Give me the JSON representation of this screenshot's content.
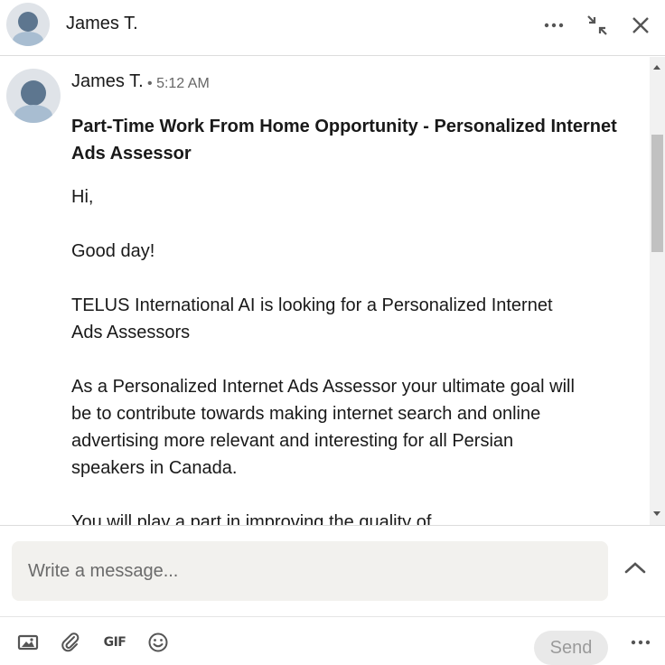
{
  "header": {
    "contact_name": "James T."
  },
  "message": {
    "sender_name": "James T.",
    "separator": "•",
    "time": "5:12 AM",
    "subject": "Part-Time Work From Home Opportunity - Personalized Internet Ads Assessor",
    "paragraphs": [
      "Hi,",
      "Good day!",
      "TELUS International AI is looking for a Personalized Internet Ads Assessors",
      "As a Personalized Internet Ads Assessor your ultimate goal will be to contribute towards making internet search and online advertising more relevant and interesting for all Persian speakers in Canada.",
      "You will play a part in improving the quality of"
    ]
  },
  "composer": {
    "placeholder": "Write a message..."
  },
  "toolbar": {
    "gif_label": "GIF",
    "send_label": "Send"
  },
  "icons": {
    "more": "more-icon",
    "minimize": "minimize-icon",
    "close": "close-icon",
    "expand": "chevron-up-icon",
    "image": "image-icon",
    "attach": "paperclip-icon",
    "emoji": "emoji-icon"
  }
}
